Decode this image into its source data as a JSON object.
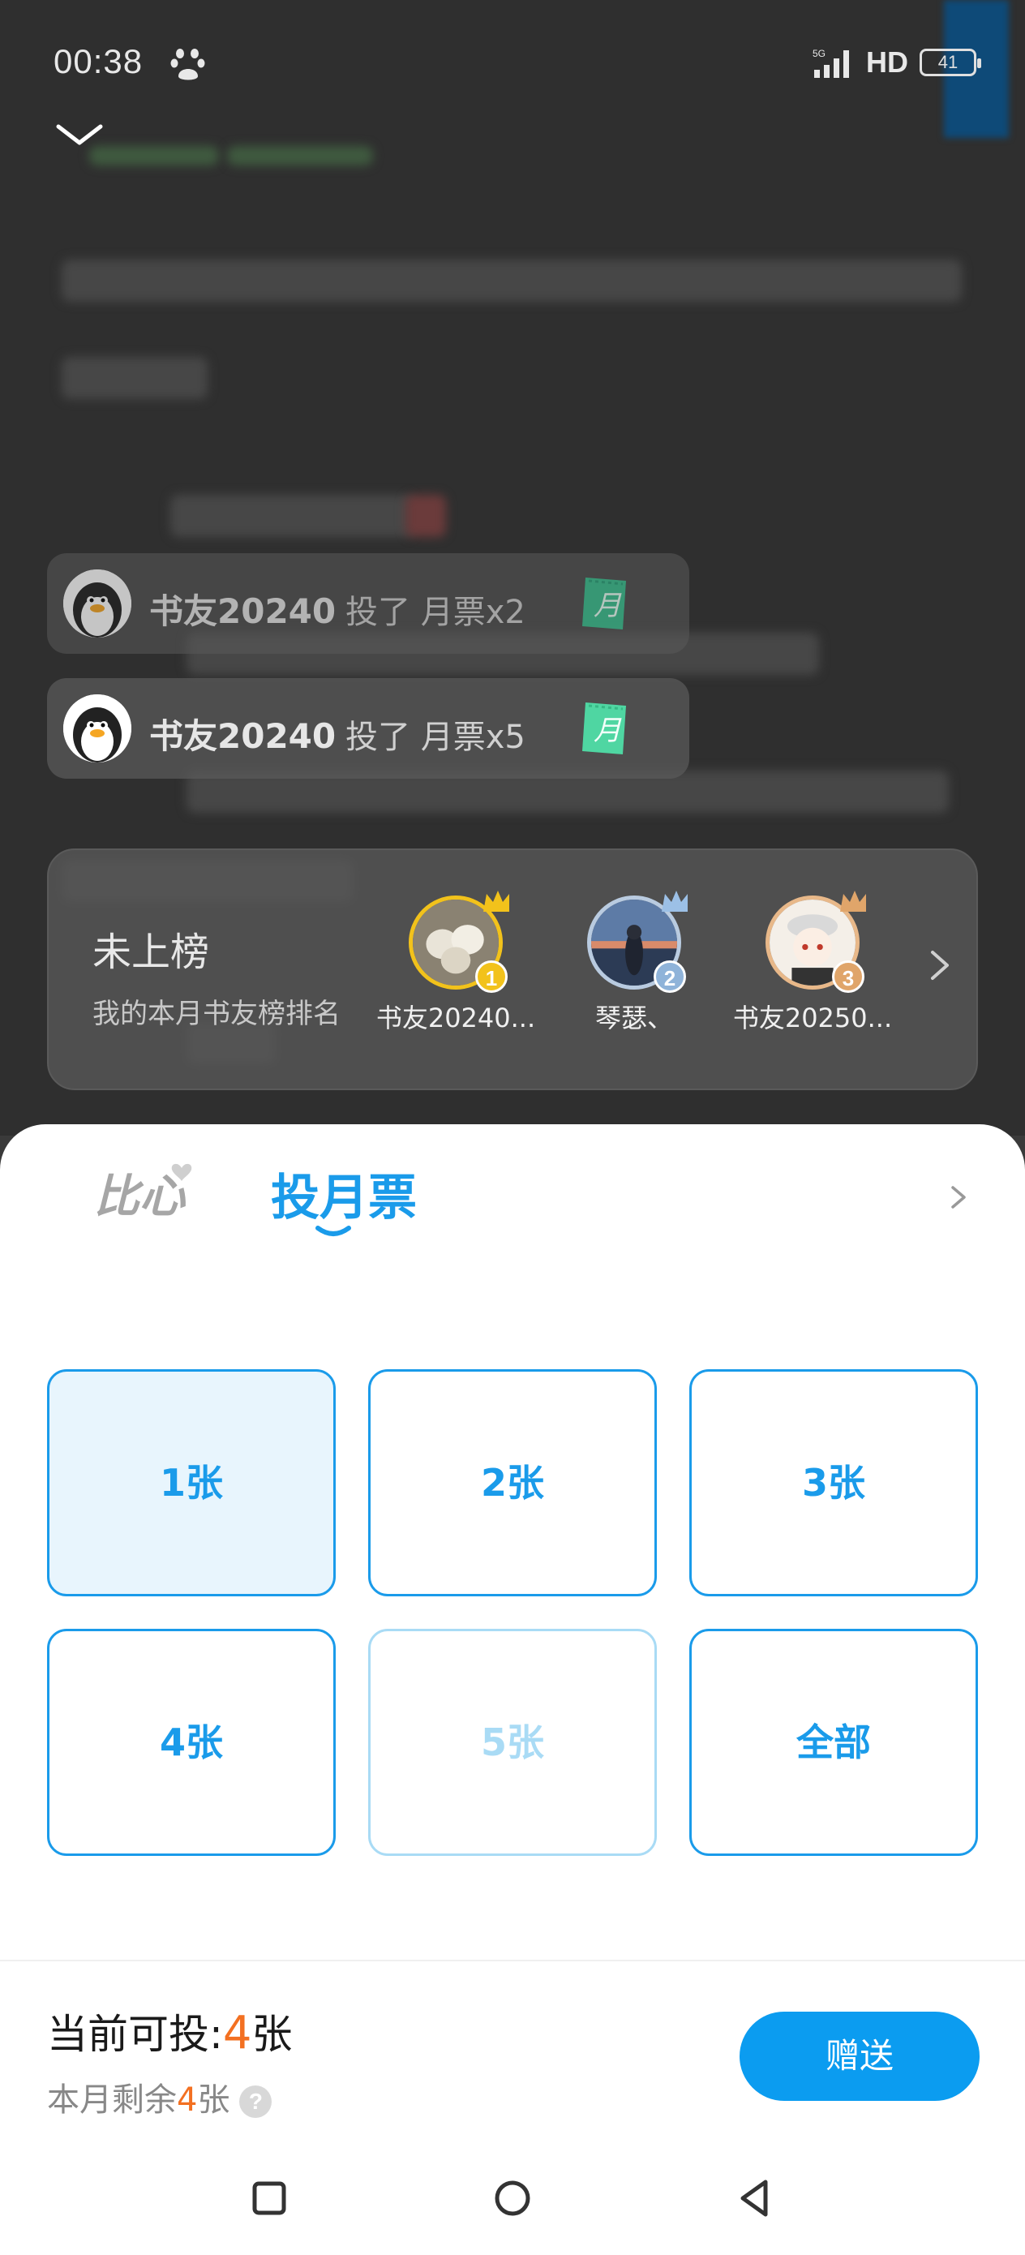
{
  "status_bar": {
    "time": "00:38",
    "network": "5G",
    "hd": "HD",
    "battery": "41"
  },
  "toasts": [
    {
      "name": "书友20240",
      "action": "投了 月票x2",
      "ticket": "月"
    },
    {
      "name": "书友20240",
      "action": "投了 月票x5",
      "ticket": "月"
    }
  ],
  "rank_card": {
    "status": "未上榜",
    "subtitle": "我的本月书友榜排名",
    "users": [
      {
        "name": "书友20240...",
        "rank": "1",
        "badge_color": "#f2c21b"
      },
      {
        "name": "琴瑟、",
        "rank": "2",
        "badge_color": "#8fb3d9"
      },
      {
        "name": "书友20250...",
        "rank": "3",
        "badge_color": "#e0a56a"
      }
    ]
  },
  "sheet": {
    "tab_inactive": "比心",
    "tab_active": "投月票",
    "options": [
      "1张",
      "2张",
      "3张",
      "4张",
      "5张",
      "全部"
    ],
    "available_label": "当前可投:",
    "available_count": "4",
    "available_unit": "张",
    "remain_label": "本月剩余",
    "remain_count": "4",
    "remain_unit": "张",
    "help": "?",
    "gift_button": "赠送"
  },
  "colors": {
    "accent": "#1a9bea",
    "highlight": "#f37021",
    "button": "#0b9cf0"
  }
}
